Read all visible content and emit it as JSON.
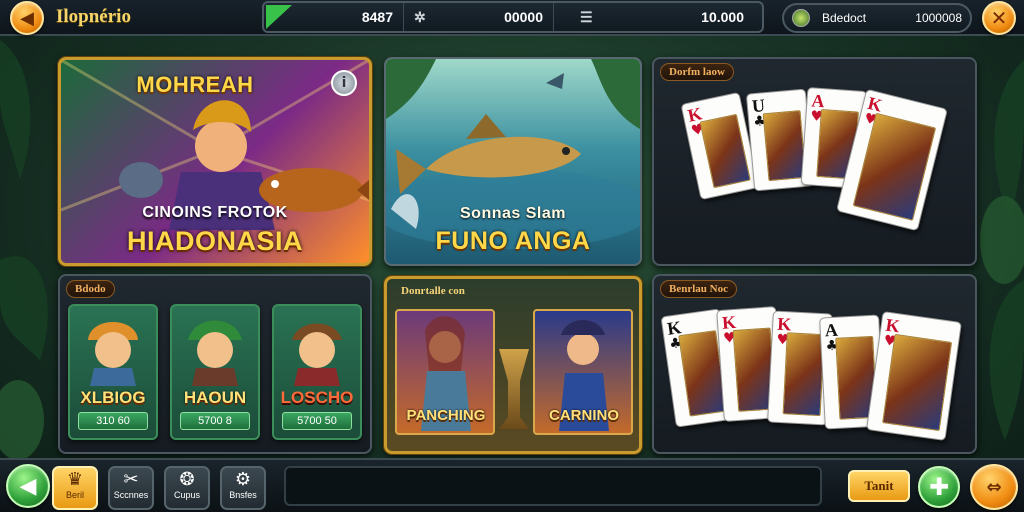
{
  "header": {
    "title": "Ilopnério",
    "back_icon": "back-arrow-icon",
    "stat_1": "8487",
    "stat_2": "00000",
    "stat_3": "10.000",
    "account_label": "Bdedoct",
    "account_value": "1000008",
    "close_icon": "close-icon"
  },
  "games": {
    "hero": {
      "logo": "MOHREAH",
      "subtitle": "CINOINS FROTOK",
      "title": "HIADONASIA"
    },
    "fishing": {
      "subtitle": "Sonnas Slam",
      "title": "FUNO ANGA"
    },
    "cards_top": {
      "tag": "Dorfm laow"
    },
    "characters": {
      "tag": "Bdodo",
      "items": [
        {
          "name": "XLBIOG",
          "price": "310 60"
        },
        {
          "name": "HAOUN",
          "price": "5700 8"
        },
        {
          "name": "LOSCHO",
          "price": "5700 50"
        }
      ]
    },
    "dual": {
      "tag": "Donrtalle con",
      "left_name": "PANCHING",
      "right_name": "CARNINO"
    },
    "cards_bottom": {
      "tag": "Benrlau Noc"
    }
  },
  "cards_top": [
    {
      "rank": "K",
      "suit": "♥"
    },
    {
      "rank": "U",
      "suit": "♣"
    },
    {
      "rank": "A",
      "suit": "♥"
    },
    {
      "rank": "K",
      "suit": "♥"
    }
  ],
  "cards_bottom": [
    {
      "rank": "K",
      "suit": "♣"
    },
    {
      "rank": "K",
      "suit": "♥"
    },
    {
      "rank": "K",
      "suit": "♥"
    },
    {
      "rank": "A",
      "suit": "♣"
    },
    {
      "rank": "K",
      "suit": "♥"
    }
  ],
  "footer": {
    "buttons": [
      "Beril",
      "Sccnnes",
      "Cupus",
      "Bnsfes"
    ],
    "action_label": "Tanit"
  },
  "colors": {
    "accent": "#f5a21a",
    "gold_frame": "#c99a2e",
    "confirm_green": "#2fa13a"
  }
}
